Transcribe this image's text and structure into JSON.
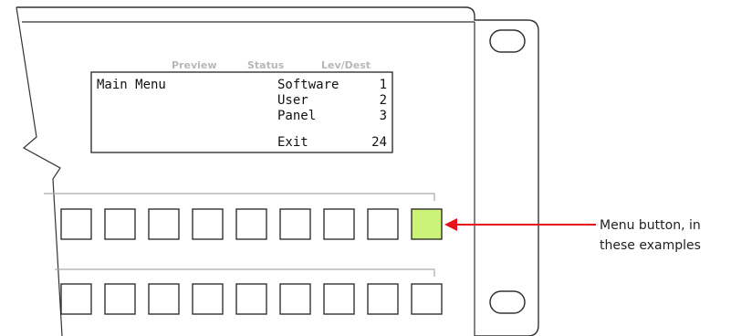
{
  "header_tabs": [
    "Preview",
    "Status",
    "Lev/Dest"
  ],
  "display": {
    "title": "Main Menu",
    "menu": [
      {
        "label": "Software",
        "number": "1"
      },
      {
        "label": "User",
        "number": "2"
      },
      {
        "label": "Panel",
        "number": "3"
      },
      {
        "label": "Exit",
        "number": "24"
      }
    ]
  },
  "buttons": {
    "row1_count": 9,
    "row2_count": 9,
    "highlighted_row1_index": 8,
    "highlight_color": "#ccf27a"
  },
  "callout": {
    "line1": "Menu button, in",
    "line2": "these examples",
    "arrow_color": "#e8101a"
  }
}
